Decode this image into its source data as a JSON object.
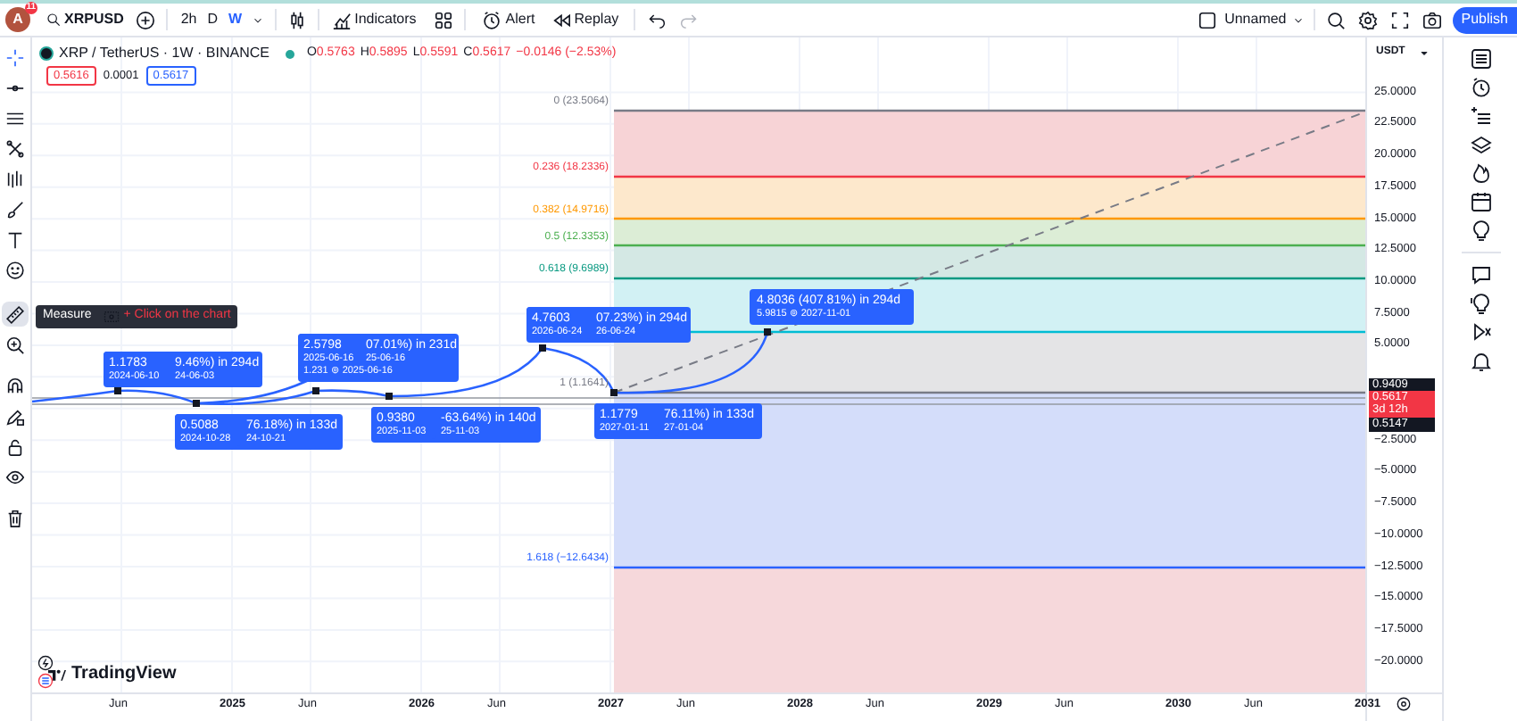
{
  "toolbar": {
    "avatar_letter": "A",
    "notification_count": "11",
    "symbol": "XRPUSD",
    "intervals": [
      {
        "label": "2h",
        "selected": false
      },
      {
        "label": "D",
        "selected": false
      },
      {
        "label": "W",
        "selected": true
      }
    ],
    "buttons": [
      {
        "kind": "indicators",
        "label": "Indicators"
      },
      {
        "kind": "alert",
        "label": "Alert"
      },
      {
        "kind": "replay",
        "label": "Replay"
      }
    ],
    "layout_name": "Unnamed",
    "publish": "Publish"
  },
  "legend": {
    "title": "XRP / TetherUS · 1W · BINANCE",
    "ohlc": [
      {
        "key": "O",
        "value": "0.5763"
      },
      {
        "key": "H",
        "value": "0.5895"
      },
      {
        "key": "L",
        "value": "0.5591"
      },
      {
        "key": "C",
        "value": "0.5617"
      }
    ],
    "change": "−0.0146 (−2.53%)",
    "sell": "0.5616",
    "spread": "0.0001",
    "buy": "0.5617"
  },
  "tooltip": {
    "title": "Measure",
    "hint": "+ Click on the chart"
  },
  "fib_levels": [
    {
      "label": "0 (23.5064)",
      "color": "#787b86"
    },
    {
      "label": "0.236 (18.2336)",
      "color": "#f23645"
    },
    {
      "label": "0.382 (14.9716)",
      "color": "#ff9800"
    },
    {
      "label": "0.5 (12.3353)",
      "color": "#4caf50"
    },
    {
      "label": "0.618 (9.6989)",
      "color": "#089981"
    },
    {
      "color": "#00bcd4"
    },
    {
      "label": "1 (1.1641)",
      "color": "#787b86"
    },
    {
      "label": "1.618 (−12.6434)",
      "color": "#2962ff"
    }
  ],
  "measurements": [
    {
      "back": [
        "9.46%) in 294d",
        "24-06-03"
      ],
      "front": [
        "1.1783",
        "2024-06-10"
      ]
    },
    {
      "back": [
        "76.18%) in 133d",
        "24-10-21"
      ],
      "front": [
        "0.5088",
        "2024-10-28"
      ]
    },
    {
      "back": [
        "07.01%) in 231d",
        "25-06-16",
        "1.231 ⊚ 2025-06-16"
      ],
      "front": [
        "2.5798",
        "2025-06-16"
      ]
    },
    {
      "back": [
        "-63.64%) in 140d",
        "25-11-03"
      ],
      "front": [
        "0.9380",
        "2025-11-03"
      ]
    },
    {
      "back": [
        "07.23%) in 294d",
        "26-06-24"
      ],
      "front": [
        "4.7603",
        "2026-06-24"
      ]
    },
    {
      "back": [
        "76.11%) in 133d",
        "27-01-04"
      ],
      "front": [
        "1.1779",
        "2027-01-11"
      ]
    },
    {
      "back": [
        "4.8036 (407.81%) in 294d",
        "5.9815 ⊚ 2027-11-01"
      ]
    }
  ],
  "price_axis": {
    "currency": "USDT",
    "ticks": [
      "25.0000",
      "22.5000",
      "20.0000",
      "17.5000",
      "15.0000",
      "12.5000",
      "10.0000",
      "7.5000",
      "5.0000",
      "−2.5000",
      "−5.0000",
      "−7.5000",
      "−10.0000",
      "−12.5000",
      "−15.0000",
      "−17.5000",
      "−20.0000"
    ],
    "tags": [
      {
        "kind": "high",
        "text": "0.9409"
      },
      {
        "kind": "price",
        "text": "0.5617"
      },
      {
        "kind": "countdown",
        "text": "3d 12h"
      },
      {
        "kind": "low",
        "text": "0.5147"
      }
    ]
  },
  "time_axis": [
    {
      "kind": "month",
      "text": "Jun"
    },
    {
      "kind": "year",
      "text": "2025"
    },
    {
      "kind": "month",
      "text": "Jun"
    },
    {
      "kind": "year",
      "text": "2026"
    },
    {
      "kind": "month",
      "text": "Jun"
    },
    {
      "kind": "year",
      "text": "2027"
    },
    {
      "kind": "month",
      "text": "Jun"
    },
    {
      "kind": "year",
      "text": "2028"
    },
    {
      "kind": "month",
      "text": "Jun"
    },
    {
      "kind": "year",
      "text": "2029"
    },
    {
      "kind": "month",
      "text": "Jun"
    },
    {
      "kind": "year",
      "text": "2030"
    },
    {
      "kind": "month",
      "text": "Jun"
    },
    {
      "kind": "year",
      "text": "2031"
    }
  ],
  "brand": "TradingView"
}
